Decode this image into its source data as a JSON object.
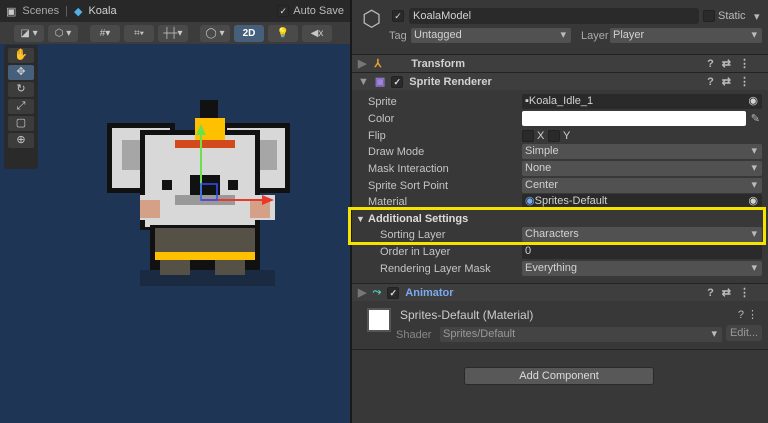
{
  "scene": {
    "tab_label": "Scenes",
    "prefab_label": "Koala",
    "auto_save_label": "Auto Save",
    "auto_save_checked": true,
    "mode_2d_label": "2D"
  },
  "inspector": {
    "object_name": "KoalaModel",
    "active": true,
    "static_label": "Static",
    "static_checked": false,
    "tag_label": "Tag",
    "tag_value": "Untagged",
    "layer_label": "Layer",
    "layer_value": "Player",
    "components": {
      "transform": "Transform",
      "sprite_renderer": "Sprite Renderer",
      "animator": "Animator"
    },
    "fields": [
      {
        "label": "Sprite",
        "value": "Koala_Idle_1"
      },
      {
        "label": "Color",
        "value": ""
      },
      {
        "label": "Flip",
        "value": ""
      },
      {
        "label": "Draw Mode",
        "value": "Simple"
      },
      {
        "label": "Mask Interaction",
        "value": "None"
      },
      {
        "label": "Sprite Sort Point",
        "value": "Center"
      },
      {
        "label": "Material",
        "value": "Sprites-Default"
      }
    ],
    "flip_x": "X",
    "flip_y": "Y",
    "additional_settings": "Additional Settings",
    "additional_fields": [
      {
        "label": "Sorting Layer",
        "value": "Characters"
      },
      {
        "label": "Order in Layer",
        "value": "0"
      },
      {
        "label": "Rendering Layer Mask",
        "value": "Everything"
      }
    ],
    "material_title": "Sprites-Default (Material)",
    "shader_label": "Shader",
    "shader_value": "Sprites/Default",
    "edit_label": "Edit...",
    "add_component": "Add Component"
  },
  "colors": {
    "highlight": "#f5e400",
    "scene_bg": "#1f3555",
    "animator_link": "#7aaaf0"
  }
}
